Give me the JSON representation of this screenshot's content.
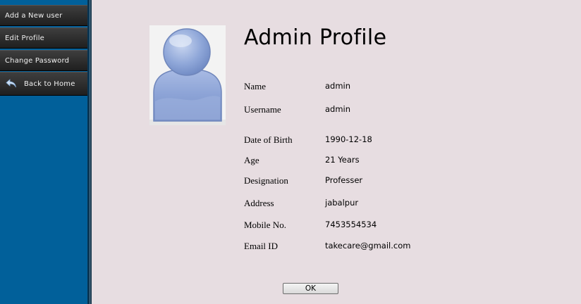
{
  "sidebar": {
    "items": [
      {
        "label": "Add a New user"
      },
      {
        "label": "Edit Profile"
      },
      {
        "label": "Change Password"
      },
      {
        "label": "Back to Home",
        "icon": "back-arrow-icon"
      }
    ]
  },
  "profile": {
    "title": "Admin Profile",
    "avatar_icon": "user-silhouette-icon",
    "fields": [
      {
        "label": "Name",
        "value": "admin"
      },
      {
        "label": "Username",
        "value": "admin"
      },
      {
        "label": "Date of Birth",
        "value": "1990-12-18"
      },
      {
        "label": "Age",
        "value": "21 Years"
      },
      {
        "label": "Designation",
        "value": "Professer"
      },
      {
        "label": "Address",
        "value": "jabalpur"
      },
      {
        "label": "Mobile No.",
        "value": "7453554534"
      },
      {
        "label": "Email ID",
        "value": "takecare@gmail.com"
      }
    ],
    "ok_label": "OK"
  },
  "colors": {
    "sidebar_bg": "#01609a",
    "page_bg": "#e7dde1",
    "menu_bg": "#2e2e2e",
    "avatar_blue": "#8aa3d4"
  }
}
